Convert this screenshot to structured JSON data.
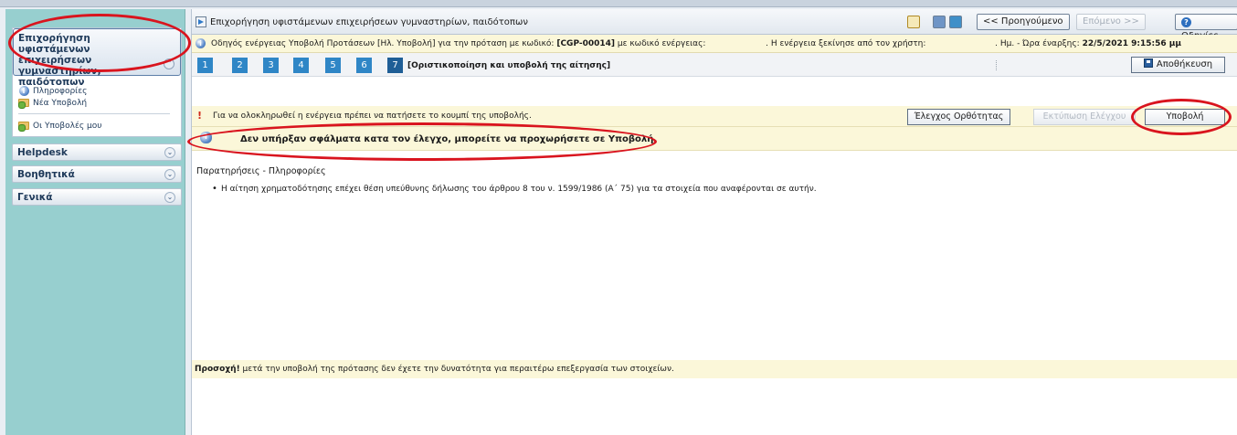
{
  "sidebar": {
    "panel_title": "Επιχορήγηση υφιστάμενων επιχειρήσεων γυμναστηρίων, παιδότοπων",
    "links": [
      "Πληροφορίες",
      "Νέα Υποβολή",
      "Οι Υποβολές μου"
    ],
    "sections": [
      "Helpdesk",
      "Βοηθητικά",
      "Γενικά"
    ]
  },
  "header": {
    "title": "Επιχορήγηση υφιστάμενων επιχειρήσεων γυμναστηρίων, παιδότοπων",
    "prev_label": "<< Προηγούμενο",
    "next_label": "Επόμενο >>",
    "help_label": "Οδηγίες"
  },
  "guide": {
    "prefix": "Οδηγός ενέργειας Υποβολή Προτάσεων [Ηλ. Υποβολή] για την πρόταση με κωδικό:",
    "code": "[CGP-00014]",
    "mid": "με κωδικό ενέργειας:",
    "started_by": ". Η ενέργεια ξεκίνησε από τον χρήστη:",
    "start_label": ". Ημ. - Ώρα έναρξης:",
    "start_value": "22/5/2021 9:15:56 μμ"
  },
  "steps": {
    "numbers": [
      "1",
      "2",
      "3",
      "4",
      "5",
      "6",
      "7"
    ],
    "current_label": "[Οριστικοποίηση και υποβολή της αίτησης]",
    "save_label": "Αποθήκευση"
  },
  "actions": {
    "warning_text": "Για να ολοκληρωθεί η ενέργεια πρέπει να πατήσετε το κουμπί της υποβολής.",
    "check_label": "Έλεγχος Ορθότητας",
    "print_label": "Εκτύπωση Ελέγχου",
    "submit_label": "Υποβολή"
  },
  "result": {
    "message": "Δεν υπήρξαν σφάλματα κατα τον έλεγχο, μπορείτε να προχωρήσετε σε Υποβολή."
  },
  "notes": {
    "heading": "Παρατηρήσεις - Πληροφορίες",
    "items": [
      "Η αίτηση χρηματοδότησης επέχει θέση υπεύθυνης δήλωσης του άρθρου 8 του ν. 1599/1986 (Α΄ 75) για τα στοιχεία που αναφέρονται σε αυτήν."
    ]
  },
  "bottom": {
    "bold": "Προσοχή!",
    "text": " μετά την υποβολή της πρότασης δεν έχετε την δυνατότητα για περαιτέρω επεξεργασία των στοιχείων."
  },
  "colors": {
    "sidebar_bg": "#97cfcf",
    "step_blue": "#2f86c6",
    "annotation_red": "#d9141e",
    "notice_bg": "#fbf7d9"
  }
}
